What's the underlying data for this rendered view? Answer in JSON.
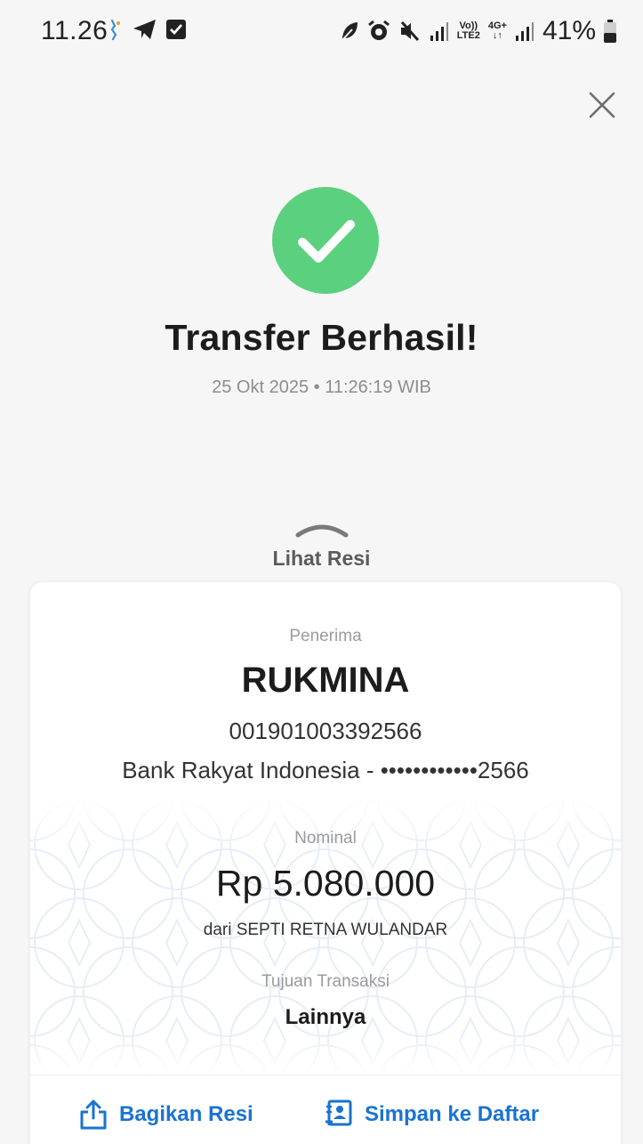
{
  "status_bar": {
    "time": "11.26",
    "battery": "41%",
    "volte": "Vo))",
    "lte": "LTE2",
    "net": "4G+"
  },
  "header": {
    "title": "Transfer Berhasil!",
    "timestamp": "25 Okt 2025 • 11:26:19 WIB"
  },
  "receipt": {
    "toggle_label": "Lihat Resi",
    "recipient_label": "Penerima",
    "recipient_name": "RUKMINA",
    "account_number": "001901003392566",
    "bank": "Bank Rakyat Indonesia - ••••••••••••2566",
    "amount_label": "Nominal",
    "amount": "Rp 5.080.000",
    "from": "dari SEPTI RETNA WULANDAR",
    "purpose_label": "Tujuan Transaksi",
    "purpose": "Lainnya"
  },
  "actions": {
    "share_label": "Bagikan Resi",
    "save_label": "Simpan ke Daftar"
  },
  "colors": {
    "success": "#5bd07e",
    "action": "#1a73d1"
  },
  "icons": [
    "close-icon",
    "check-icon",
    "chevron-up-icon",
    "share-icon",
    "contact-save-icon"
  ]
}
